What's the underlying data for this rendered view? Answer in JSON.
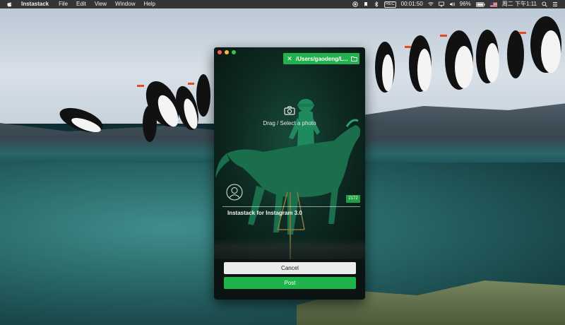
{
  "menubar": {
    "app_name": "Instastack",
    "menus": [
      "File",
      "Edit",
      "View",
      "Window",
      "Help"
    ],
    "timer": "00:01:50",
    "battery": "96%",
    "clock": "周二 下午1:11",
    "icons": [
      "record-icon",
      "bookmark-icon",
      "bluetooth-icon",
      "screen-recorder-icon",
      "wifi-icon",
      "airplay-icon",
      "volume-icon",
      "battery-icon",
      "flag-icon",
      "search-icon",
      "list-icon"
    ]
  },
  "window": {
    "path": "/Users/gaodeng/L...",
    "drag_label": "Drag / Select a photo",
    "char_count": "2172",
    "caption": "Instastack for Instagram 3.0",
    "cancel_label": "Cancel",
    "post_label": "Post",
    "accent_color": "#21b34b"
  }
}
